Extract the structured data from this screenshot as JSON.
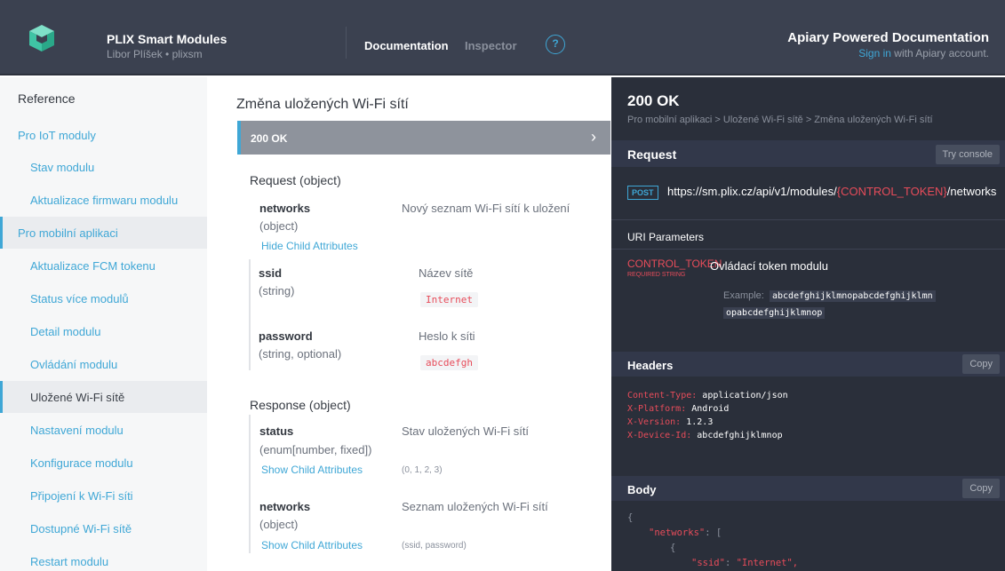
{
  "header": {
    "brand_title": "PLIX Smart Modules",
    "brand_subtitle": "Libor Plíšek • plixsm",
    "nav_documentation": "Documentation",
    "nav_inspector": "Inspector",
    "help_glyph": "?",
    "apiary_title": "Apiary Powered Documentation",
    "signin_link": "Sign in",
    "signin_rest": " with Apiary account."
  },
  "sidebar": {
    "reference": "Reference",
    "items": [
      {
        "label": "Pro IoT moduly"
      },
      {
        "label": "Stav modulu"
      },
      {
        "label": "Aktualizace firmwaru modulu"
      },
      {
        "label": "Pro mobilní aplikaci"
      },
      {
        "label": "Aktualizace FCM tokenu"
      },
      {
        "label": "Status více modulů"
      },
      {
        "label": "Detail modulu"
      },
      {
        "label": "Ovládání modulu"
      },
      {
        "label": "Uložené Wi-Fi sítě"
      },
      {
        "label": "Nastavení modulu"
      },
      {
        "label": "Konfigurace modulu"
      },
      {
        "label": "Připojení k Wi-Fi síti"
      },
      {
        "label": "Dostupné Wi-Fi sítě"
      },
      {
        "label": "Restart modulu"
      }
    ]
  },
  "main": {
    "title": "Změna uložených Wi-Fi sítí",
    "response_bar": "200 OK",
    "request": {
      "label": "Request",
      "type": " (object)",
      "networks": {
        "name": "networks",
        "type": "(object)",
        "desc": "Nový seznam Wi-Fi sítí k uložení",
        "link": "Hide Child Attributes"
      },
      "ssid": {
        "name": "ssid",
        "type": "(string)",
        "desc": "Název sítě",
        "example": "Internet"
      },
      "password": {
        "name": "password",
        "type": "(string, optional)",
        "desc": "Heslo k síti",
        "example": "abcdefgh"
      }
    },
    "response": {
      "label": "Response",
      "type": " (object)",
      "status": {
        "name": "status",
        "type": "(enum[number, fixed])",
        "desc": "Stav uložených Wi-Fi sítí",
        "link": "Show Child Attributes",
        "hint": "(0, 1, 2, 3)"
      },
      "networks": {
        "name": "networks",
        "type": "(object)",
        "desc": "Seznam uložených Wi-Fi sítí",
        "link": "Show Child Attributes",
        "hint": "(ssid, password)"
      }
    }
  },
  "panel": {
    "status": "200 OK",
    "breadcrumb": "Pro mobilní aplikaci  >  Uložené Wi-Fi sítě  >  Změna uložených Wi-Fi sítí",
    "request_label": "Request",
    "try_console": "Try console",
    "method": "POST",
    "url_prefix": "https://sm.plix.cz/api/v1/modules/",
    "url_token": "{CONTROL_TOKEN}",
    "url_suffix": "/networks",
    "uri_params": "URI Parameters",
    "param_name": "CONTROL_TOKEN",
    "param_required": "REQUIRED STRING",
    "param_desc": "Ovládací token modulu",
    "example_label": "Example:",
    "example_1": "abcdefghijklmnopabcdefghijklmn",
    "example_2": "opabcdefghijklmnop",
    "headers_label": "Headers",
    "copy": "Copy",
    "headers": [
      {
        "k": "Content-Type: ",
        "v": "application/json"
      },
      {
        "k": "X-Platform: ",
        "v": "Android"
      },
      {
        "k": "X-Version: ",
        "v": "1.2.3"
      },
      {
        "k": "X-Device-Id: ",
        "v": "abcdefghijklmnop"
      }
    ],
    "body_label": "Body",
    "json": {
      "l1": "{",
      "l2_key": "\"networks\"",
      "l2_punct": ": [",
      "l3": "{",
      "l4_key": "\"ssid\"",
      "l4_punct": ": ",
      "l4_val": "\"Internet\","
    }
  }
}
